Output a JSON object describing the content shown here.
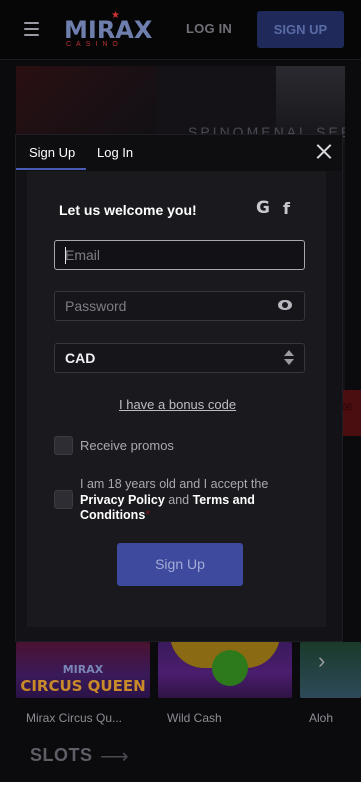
{
  "header": {
    "logo": {
      "word": "MIRAX",
      "sub": "CASINO"
    },
    "menu_icon": "hamburger-icon",
    "login_label": "LOG IN",
    "signup_label": "SIGN UP"
  },
  "background": {
    "hero_text": "SPINOMENAL SEE",
    "games": [
      {
        "label": "Mirax Circus Qu...",
        "tile_title": "MIRAX",
        "tile_subtitle": "CIRCUS QUEEN"
      },
      {
        "label": "Wild Cash"
      },
      {
        "label": "Aloh"
      }
    ],
    "section_title": "SLOTS"
  },
  "modal": {
    "tabs": [
      {
        "label": "Sign Up",
        "active": true
      },
      {
        "label": "Log In",
        "active": false
      }
    ],
    "welcome": "Let us welcome you!",
    "social": {
      "google": "G",
      "facebook": "f"
    },
    "email": {
      "placeholder": "Email",
      "value": ""
    },
    "password": {
      "placeholder": "Password",
      "value": ""
    },
    "currency": {
      "selected": "CAD"
    },
    "bonus_link": "I have a bonus code",
    "promos_label": "Receive promos",
    "age_consent": {
      "text_before": "I am 18 years old and I accept the ",
      "privacy": "Privacy Policy",
      "and": " and ",
      "terms": "Terms and Conditions",
      "required_mark": "*"
    },
    "submit_label": "Sign Up"
  },
  "colors": {
    "accent": "#3d4a9e",
    "tab_underline": "#4a5bb6",
    "page_bg": "#0b0b0d",
    "modal_bg": "#131317"
  }
}
